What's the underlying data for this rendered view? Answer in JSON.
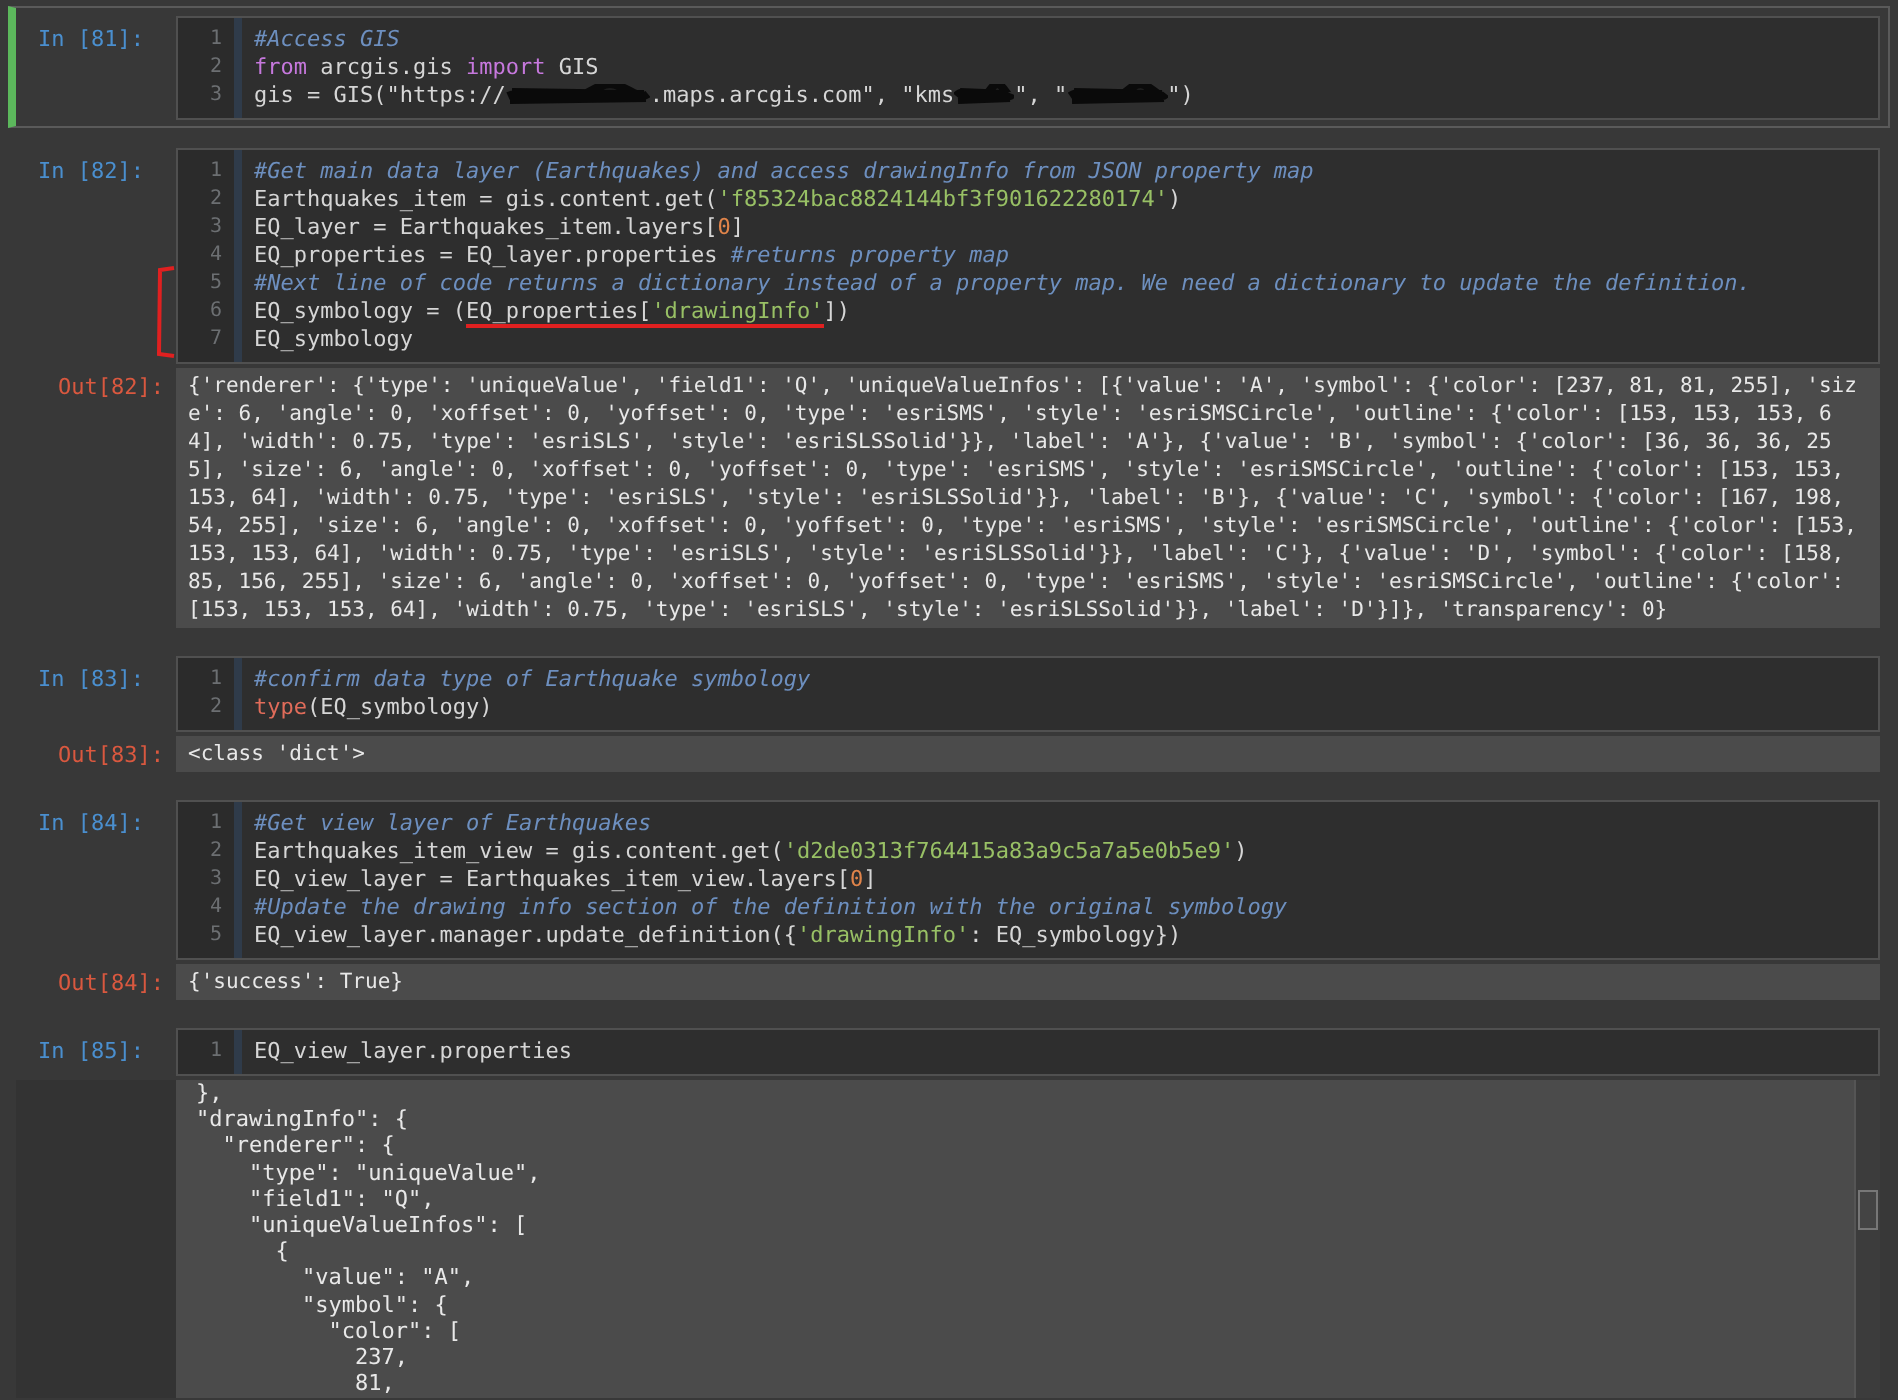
{
  "cells": [
    {
      "prompt": "In [81]:",
      "selected": true,
      "lines": [
        {
          "number": "1",
          "tokens": [
            {
              "kind": "comment",
              "text": "#Access GIS"
            }
          ]
        },
        {
          "number": "2",
          "tokens": [
            {
              "kind": "keyword",
              "text": "from"
            },
            {
              "kind": "plain",
              "text": " arcgis.gis "
            },
            {
              "kind": "keyword",
              "text": "import"
            },
            {
              "kind": "plain",
              "text": " GIS"
            }
          ]
        },
        {
          "number": "3",
          "tokens": [
            {
              "kind": "plain",
              "text": "gis = GIS(\"https://"
            },
            {
              "kind": "redacted"
            },
            {
              "kind": "plain",
              "text": ".maps.arcgis.com\", \"kms"
            },
            {
              "kind": "redacted"
            },
            {
              "kind": "plain",
              "text": "\", \""
            },
            {
              "kind": "redacted"
            },
            {
              "kind": "plain",
              "text": "\")"
            }
          ]
        }
      ]
    },
    {
      "prompt": "In [82]:",
      "selected": false,
      "lines": [
        {
          "number": "1",
          "tokens": [
            {
              "kind": "comment",
              "text": "#Get main data layer (Earthquakes) and access drawingInfo from JSON property map"
            }
          ]
        },
        {
          "number": "2",
          "tokens": [
            {
              "kind": "plain",
              "text": "Earthquakes_item = gis.content.get("
            },
            {
              "kind": "string",
              "text": "'f85324bac8824144bf3f901622280174'"
            },
            {
              "kind": "plain",
              "text": ")"
            }
          ]
        },
        {
          "number": "3",
          "tokens": [
            {
              "kind": "plain",
              "text": "EQ_layer = Earthquakes_item.layers["
            },
            {
              "kind": "number",
              "text": "0"
            },
            {
              "kind": "plain",
              "text": "]"
            }
          ]
        },
        {
          "number": "4",
          "tokens": [
            {
              "kind": "plain",
              "text": "EQ_properties = EQ_layer.properties "
            },
            {
              "kind": "comment",
              "text": "#returns property map"
            }
          ]
        },
        {
          "number": "5",
          "bracketed": true,
          "tokens": [
            {
              "kind": "comment",
              "text": "#Next line of code returns a dictionary instead of a property map. We need a dictionary to update the definition."
            }
          ]
        },
        {
          "number": "6",
          "bracketed": true,
          "tokens": [
            {
              "kind": "plain",
              "text": "EQ_symbology = ("
            },
            {
              "kind": "plain",
              "text": "EQ_properties[",
              "underlined": true
            },
            {
              "kind": "string",
              "text": "'drawingInfo'",
              "underlined": true
            },
            {
              "kind": "plain",
              "text": "])"
            }
          ]
        },
        {
          "number": "7",
          "bracketed": true,
          "tokens": [
            {
              "kind": "plain",
              "text": "EQ_symbology"
            }
          ]
        }
      ],
      "output": {
        "prompt": "Out[82]:",
        "kind": "text",
        "text": "{'renderer': {'type': 'uniqueValue', 'field1': 'Q', 'uniqueValueInfos': [{'value': 'A', 'symbol': {'color': [237, 81, 81, 255], 'size': 6, 'angle': 0, 'xoffset': 0, 'yoffset': 0, 'type': 'esriSMS', 'style': 'esriSMSCircle', 'outline': {'color': [153, 153, 153, 64], 'width': 0.75, 'type': 'esriSLS', 'style': 'esriSLSSolid'}}, 'label': 'A'}, {'value': 'B', 'symbol': {'color': [36, 36, 36, 255], 'size': 6, 'angle': 0, 'xoffset': 0, 'yoffset': 0, 'type': 'esriSMS', 'style': 'esriSMSCircle', 'outline': {'color': [153, 153, 153, 64], 'width': 0.75, 'type': 'esriSLS', 'style': 'esriSLSSolid'}}, 'label': 'B'}, {'value': 'C', 'symbol': {'color': [167, 198, 54, 255], 'size': 6, 'angle': 0, 'xoffset': 0, 'yoffset': 0, 'type': 'esriSMS', 'style': 'esriSMSCircle', 'outline': {'color': [153, 153, 153, 64], 'width': 0.75, 'type': 'esriSLS', 'style': 'esriSLSSolid'}}, 'label': 'C'}, {'value': 'D', 'symbol': {'color': [158, 85, 156, 255], 'size': 6, 'angle': 0, 'xoffset': 0, 'yoffset': 0, 'type': 'esriSMS', 'style': 'esriSMSCircle', 'outline': {'color': [153, 153, 153, 64], 'width': 0.75, 'type': 'esriSLS', 'style': 'esriSLSSolid'}}, 'label': 'D'}]}, 'transparency': 0}"
      }
    },
    {
      "prompt": "In [83]:",
      "selected": false,
      "lines": [
        {
          "number": "1",
          "tokens": [
            {
              "kind": "comment",
              "text": "#confirm data type of Earthquake symbology"
            }
          ]
        },
        {
          "number": "2",
          "tokens": [
            {
              "kind": "builtin",
              "text": "type"
            },
            {
              "kind": "plain",
              "text": "(EQ_symbology)"
            }
          ]
        }
      ],
      "output": {
        "prompt": "Out[83]:",
        "kind": "text",
        "text": "<class 'dict'>"
      }
    },
    {
      "prompt": "In [84]:",
      "selected": false,
      "lines": [
        {
          "number": "1",
          "tokens": [
            {
              "kind": "comment",
              "text": "#Get view layer of Earthquakes"
            }
          ]
        },
        {
          "number": "2",
          "tokens": [
            {
              "kind": "plain",
              "text": "Earthquakes_item_view = gis.content.get("
            },
            {
              "kind": "string",
              "text": "'d2de0313f764415a83a9c5a7a5e0b5e9'"
            },
            {
              "kind": "plain",
              "text": ")"
            }
          ]
        },
        {
          "number": "3",
          "tokens": [
            {
              "kind": "plain",
              "text": "EQ_view_layer = Earthquakes_item_view.layers["
            },
            {
              "kind": "number",
              "text": "0"
            },
            {
              "kind": "plain",
              "text": "]"
            }
          ]
        },
        {
          "number": "4",
          "tokens": [
            {
              "kind": "comment",
              "text": "#Update the drawing info section of the definition with the original symbology"
            }
          ]
        },
        {
          "number": "5",
          "tokens": [
            {
              "kind": "plain",
              "text": "EQ_view_layer.manager.update_definition({"
            },
            {
              "kind": "string",
              "text": "'drawingInfo'"
            },
            {
              "kind": "plain",
              "text": ": EQ_symbology})"
            }
          ]
        }
      ],
      "output": {
        "prompt": "Out[84]:",
        "kind": "text",
        "text": "{'success': True}"
      }
    },
    {
      "prompt": "In [85]:",
      "selected": false,
      "lines": [
        {
          "number": "1",
          "tokens": [
            {
              "kind": "plain",
              "text": "EQ_view_layer.properties"
            }
          ]
        }
      ],
      "output": {
        "kind": "scrolled",
        "lines": [
          "},",
          "\"drawingInfo\": {",
          "  \"renderer\": {",
          "    \"type\": \"uniqueValue\",",
          "    \"field1\": \"Q\",",
          "    \"uniqueValueInfos\": [",
          "      {",
          "        \"value\": \"A\",",
          "        \"symbol\": {",
          "          \"color\": [",
          "            237,",
          "            81,"
        ]
      }
    }
  ]
}
